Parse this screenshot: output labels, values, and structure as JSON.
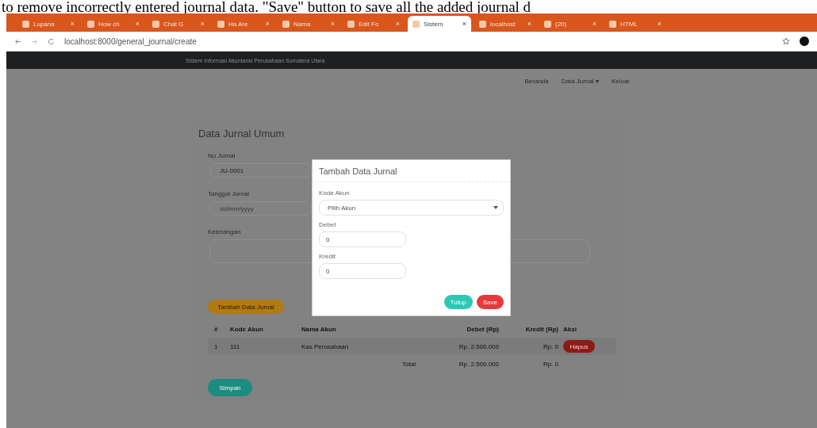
{
  "caption": "to remove incorrectly entered journal data. \"Save\" button to save all the added journal d",
  "browser": {
    "tabs": [
      {
        "title": "Lupana",
        "close": "×",
        "selected": false
      },
      {
        "title": "How ch",
        "close": "×",
        "selected": false
      },
      {
        "title": "Chat G",
        "close": "×",
        "selected": false
      },
      {
        "title": "Ha Are",
        "close": "×",
        "selected": false
      },
      {
        "title": "Nama",
        "close": "×",
        "selected": false
      },
      {
        "title": "Edit Fo",
        "close": "×",
        "selected": false
      },
      {
        "title": "Sistem",
        "close": "×",
        "selected": true
      },
      {
        "title": "localhost",
        "close": "×",
        "selected": false
      },
      {
        "title": "(20)",
        "close": "×",
        "selected": false
      },
      {
        "title": "HTML",
        "close": "×",
        "selected": false
      }
    ],
    "address": "localhost:8000/general_journal/create"
  },
  "navbar": {
    "brand": "Sistem Informasi Akuntansi Perusahaan Sumatera Utara",
    "links": [
      "Beranda",
      "Data Jurnal ▾",
      "Keluar"
    ]
  },
  "form": {
    "title": "Data Jurnal Umum",
    "fields": [
      {
        "label": "No Jurnal",
        "value": "JU-0001"
      },
      {
        "label": "Tanggal Jurnal",
        "placeholder": "dd/mm/yyyy"
      },
      {
        "label": "Keterangan"
      }
    ],
    "add_button": "Tambah Data Jurnal",
    "table": {
      "columns": [
        "#",
        "Kode Akun",
        "Nama Akun",
        "Debet (Rp)",
        "Kredit (Rp)",
        "Aksi"
      ],
      "rows": [
        {
          "cells": [
            "1",
            "111",
            "Kas Perusahaan",
            "Rp. 2.500.000",
            "Rp. 0"
          ],
          "action": "Hapus"
        }
      ],
      "total": {
        "label": "Total",
        "debit": "Rp. 2.500.000",
        "credit": "Rp. 0"
      }
    },
    "save_button": "Simpan"
  },
  "modal": {
    "title": "Tambah Data Jurnal",
    "account_label": "Kode Akun",
    "account_placeholder": "Pilih Akun",
    "fields": [
      {
        "label": "Debet",
        "value": "0"
      },
      {
        "label": "Kredit",
        "value": "0"
      }
    ],
    "buttons": [
      {
        "label": "Tutup",
        "kind": "secondary"
      },
      {
        "label": "Save",
        "kind": "primary"
      }
    ]
  }
}
